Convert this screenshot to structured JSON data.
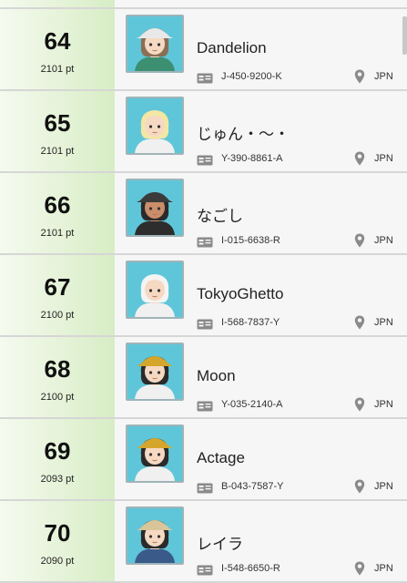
{
  "leaderboard": {
    "entries": [
      {
        "rank": "64",
        "points": "2101 pt",
        "name": "Dandelion",
        "friend_code": "J-450-9200-K",
        "country": "JPN",
        "avatar": {
          "skin": "#f6d9c3",
          "hair": "#8a6f55",
          "hat": "#e8e8e8",
          "shirt": "#3d8f72",
          "bg": "#5fc6d9"
        }
      },
      {
        "rank": "65",
        "points": "2101 pt",
        "name": "じゅん・～・",
        "friend_code": "Y-390-8861-A",
        "country": "JPN",
        "avatar": {
          "skin": "#f6d9c3",
          "hair": "#f3e7a4",
          "hat": "",
          "shirt": "#f0f0f0",
          "bg": "#5fc6d9"
        }
      },
      {
        "rank": "66",
        "points": "2101 pt",
        "name": "なごし",
        "friend_code": "I-015-6638-R",
        "country": "JPN",
        "avatar": {
          "skin": "#c98e6a",
          "hair": "#2a2a2a",
          "hat": "#3b3b3b",
          "shirt": "#2d2d2d",
          "bg": "#5fc6d9"
        }
      },
      {
        "rank": "67",
        "points": "2100 pt",
        "name": "TokyoGhetto",
        "friend_code": "I-568-7837-Y",
        "country": "JPN",
        "avatar": {
          "skin": "#f6d9c3",
          "hair": "#f4f4f4",
          "hat": "",
          "shirt": "#f0f0f0",
          "bg": "#5fc6d9"
        }
      },
      {
        "rank": "68",
        "points": "2100 pt",
        "name": "Moon",
        "friend_code": "Y-035-2140-A",
        "country": "JPN",
        "avatar": {
          "skin": "#f6d9c3",
          "hair": "#2b2b2b",
          "hat": "#d4a72c",
          "shirt": "#f0f0f0",
          "bg": "#5fc6d9"
        }
      },
      {
        "rank": "69",
        "points": "2093 pt",
        "name": "Actage",
        "friend_code": "B-043-7587-Y",
        "country": "JPN",
        "avatar": {
          "skin": "#f6d9c3",
          "hair": "#2b2b2b",
          "hat": "#d4a72c",
          "shirt": "#f0f0f0",
          "bg": "#5fc6d9"
        }
      },
      {
        "rank": "70",
        "points": "2090 pt",
        "name": "レイラ",
        "friend_code": "I-548-6650-R",
        "country": "JPN",
        "avatar": {
          "skin": "#f6d9c3",
          "hair": "#2a2a2a",
          "hat": "#d8c69a",
          "shirt": "#3a5a8a",
          "bg": "#5fc6d9"
        }
      }
    ]
  },
  "colors": {
    "rank_cell_green": "#d7edc5",
    "row_bg": "#f6f6f6",
    "divider": "#d6d6d6",
    "icon_gray": "#8a8a8a"
  },
  "icons": {
    "friend_code": "id-card-icon",
    "location": "location-pin-icon"
  }
}
